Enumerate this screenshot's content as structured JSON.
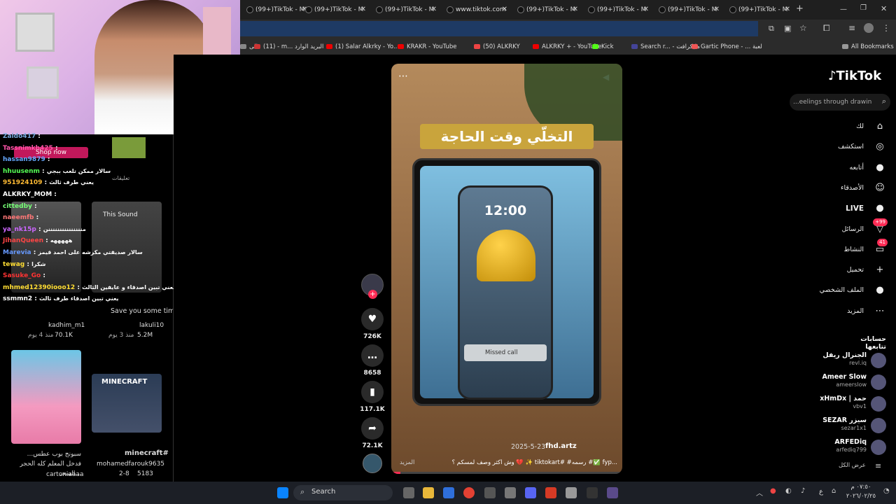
{
  "tabs": [
    {
      "label": "(99+)TikTok - M"
    },
    {
      "label": "(99+)TikTok - M"
    },
    {
      "label": "(99+)TikTok - M"
    },
    {
      "label": "www.tiktok.com"
    },
    {
      "label": "(99+)TikTok - M"
    },
    {
      "label": "(99+)TikTok - M"
    },
    {
      "label": "(99+)TikTok - M"
    },
    {
      "label": "(99+)TikTok - M"
    }
  ],
  "bookmarks": [
    {
      "label": "الى",
      "color": "#888"
    },
    {
      "label": "(11) - m... البريد الوارد",
      "color": "#c33"
    },
    {
      "label": "(1) Salar Alkrky - Yo...",
      "color": "#e00"
    },
    {
      "label": "KRAKR - YouTube",
      "color": "#e00"
    },
    {
      "label": "(50) ALKRKY",
      "color": "#e44"
    },
    {
      "label": "ALKRKY + - YouTube",
      "color": "#e00"
    },
    {
      "label": "Kick",
      "color": "#53fc18"
    },
    {
      "label": "Search r... - مايكرافت",
      "color": "#449"
    },
    {
      "label": "Gartic Phone - ... لعبة",
      "color": "#e55"
    },
    {
      "label": "All Bookmarks",
      "color": "#999"
    }
  ],
  "chat": [
    {
      "user": "Zaido417",
      "msg": "",
      "color": "#7ad"
    },
    {
      "user": "Tassnimkh425",
      "msg": "",
      "color": "#f5a"
    },
    {
      "user": "hassan9879",
      "msg": "",
      "color": "#6af"
    },
    {
      "user": "hhuusenm",
      "msg": "سالار ممكن تلعب ببجي",
      "color": "#5f5"
    },
    {
      "user": "951924109",
      "msg": "يعني طرف ثالث",
      "color": "#fb3"
    },
    {
      "user": "ALKRKY_MOM",
      "msg": "",
      "color": "#fff"
    },
    {
      "user": "cittedby",
      "msg": "",
      "color": "#7f7"
    },
    {
      "user": "naeemfb",
      "msg": "",
      "color": "#f77"
    },
    {
      "user": "ya_nk15p",
      "msg": "منننننننننننننننن",
      "color": "#c6f"
    },
    {
      "user": "JihanQueen",
      "msg": "هههههه",
      "color": "#f44"
    },
    {
      "user": "Marevia",
      "msg": "سالار صديقتي مكرشه على احمد قيمز",
      "color": "#69f"
    },
    {
      "user": "tewag",
      "msg": "شكرا",
      "color": "#fd3"
    },
    {
      "user": "Sasuke_Go",
      "msg": "",
      "color": "#f33"
    },
    {
      "user": "mhmed12390iooo12",
      "msg": "يعني تبين اصدقاء و عايفين الثالث",
      "color": "#fd3"
    },
    {
      "user": "ssmmn2",
      "msg": "يعني تبين اصدقاء طرف ثالث",
      "color": "#fff"
    }
  ],
  "left": {
    "comments_label": "تعليقات",
    "shop_label": "Shop now",
    "v1": {
      "author": "kadhim_m1",
      "likes": "70.1K",
      "age": "منذ 4 يوم"
    },
    "v2": {
      "title": "Save you some time #fyp...",
      "author": "lakuli10",
      "likes": "5.2M",
      "age": "منذ 3 يوم",
      "sound": "This Sound"
    },
    "v3": {
      "title": "سبونج بوب عطس... فدخل المعلم كله الحجر السحـ...",
      "author": "cartoniaaaa"
    },
    "v4": {
      "title": "minecraft#",
      "author": "mohamedfarouk9635",
      "likes": "5183",
      "date": "2-8"
    }
  },
  "video": {
    "headline": "التخلّي وقت الحاجة",
    "clock": "12:00",
    "missed_call": "Missed call",
    "date": "2025-5-23",
    "author": "fhd.artz",
    "caption": "وش أكثر وصف لمسكم ؟ 💔 ✨ tiktokart# #رسمه #✅ fyp...",
    "more": "المزيد"
  },
  "actions": {
    "likes": "726K",
    "comments": "8658",
    "saves": "117.1K",
    "shares": "72.1K"
  },
  "sidebar": {
    "logo": "TikTok",
    "search_placeholder": "...eelings through drawing",
    "nav": [
      {
        "label": "لك",
        "icon": "⌂"
      },
      {
        "label": "استكشف",
        "icon": "◎"
      },
      {
        "label": "أتابعه",
        "icon": "●"
      },
      {
        "label": "الأصدقاء",
        "icon": "☺"
      },
      {
        "label": "LIVE",
        "icon": "●"
      },
      {
        "label": "الرسائل",
        "icon": "▽",
        "badge": "+99"
      },
      {
        "label": "النشاط",
        "icon": "▭",
        "badge": "41"
      },
      {
        "label": "تحميل",
        "icon": "+"
      },
      {
        "label": "الملف الشخصي",
        "icon": "●"
      },
      {
        "label": "المزيد",
        "icon": "⋯"
      }
    ],
    "following_title": "حسابات تتابعها",
    "following": [
      {
        "name": "الجنرال ريفل",
        "handle": "revl.iq"
      },
      {
        "name": "Ameer Slow",
        "handle": "ameerslow"
      },
      {
        "name": "xHmDx | حمد",
        "handle": "vbv1"
      },
      {
        "name": "SEZAR سيزر",
        "handle": "sezar1x1"
      },
      {
        "name": "ARFEDiq",
        "handle": "arfediq799"
      }
    ],
    "show_all": "عرض الكل"
  },
  "taskbar": {
    "search": "Search",
    "lang": "ع",
    "time": "٠٧:٥٠ م",
    "date": "٢٠٢٦/٠٢/٢٥"
  }
}
